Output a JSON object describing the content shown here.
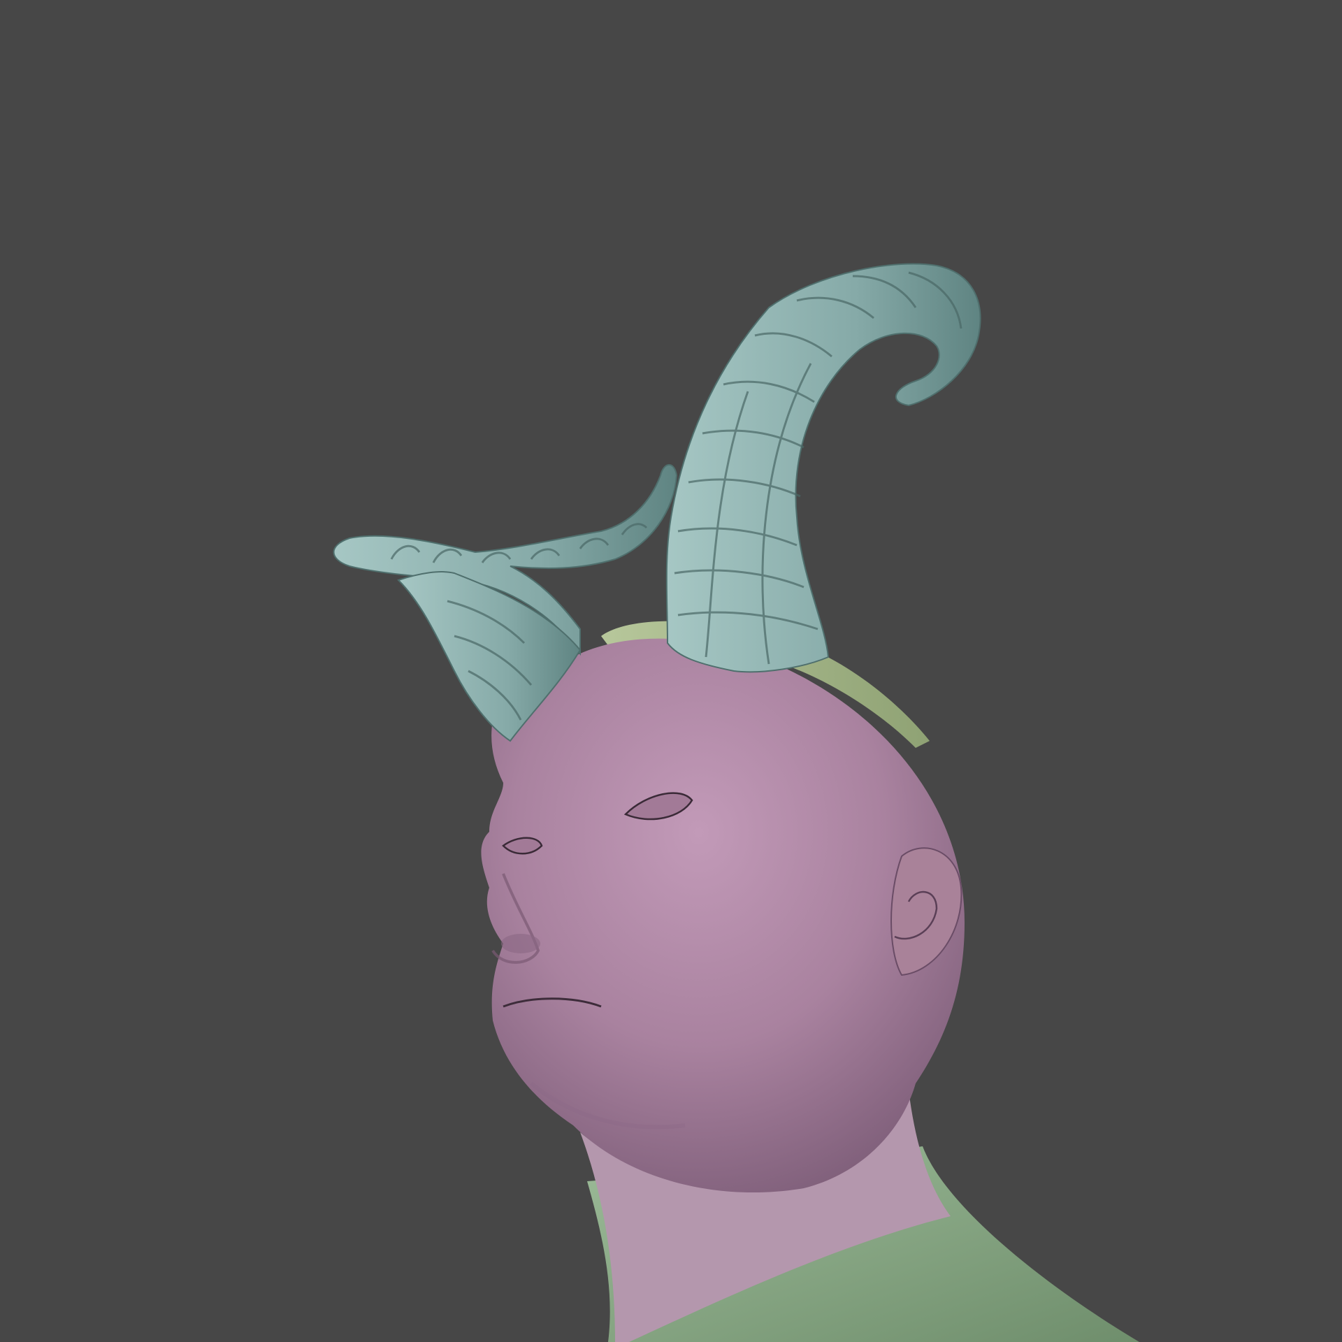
{
  "viewport": {
    "background_color": "#474747"
  },
  "model": {
    "parts": [
      {
        "name": "head",
        "color": "#a9829f",
        "description_icon": "head-mesh"
      },
      {
        "name": "neck-shirt",
        "color": "#8aa987",
        "description_icon": "shirt-mesh"
      },
      {
        "name": "headband",
        "color": "#9cae7f",
        "description_icon": "headband-mesh"
      },
      {
        "name": "horn-right",
        "color": "#86aaa8",
        "description_icon": "horn-mesh"
      },
      {
        "name": "horn-left",
        "color": "#86aaa8",
        "description_icon": "horn-mesh"
      }
    ]
  }
}
